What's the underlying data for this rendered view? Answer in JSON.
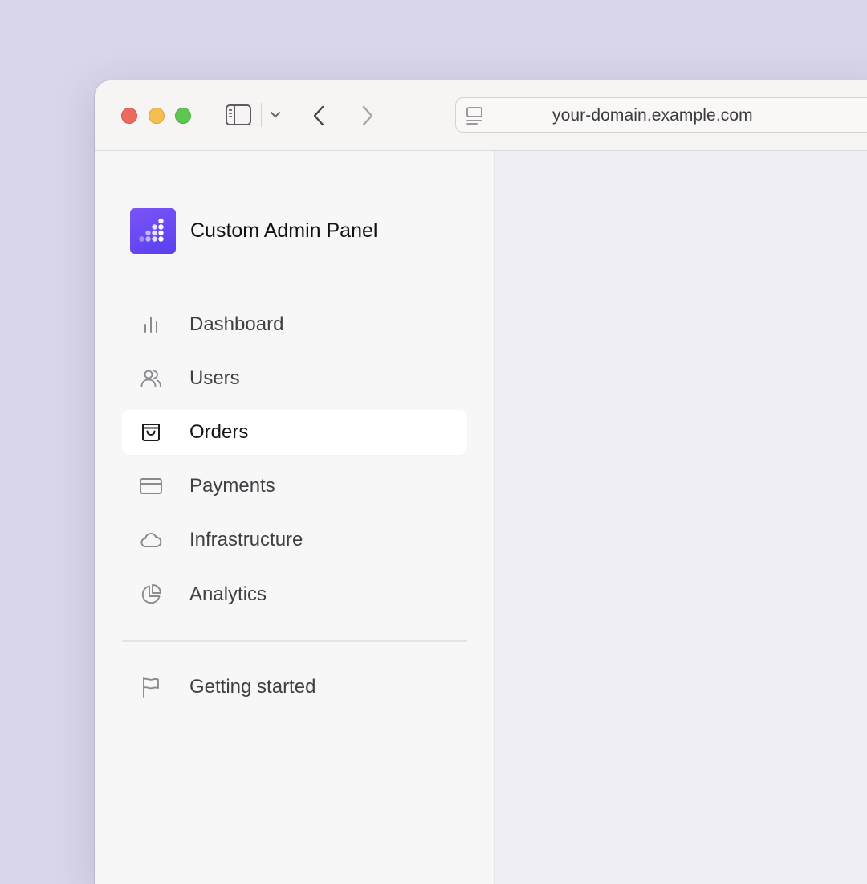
{
  "browser": {
    "url": "your-domain.example.com",
    "icons": [
      "sidebar-toggle-icon",
      "chevron-down-icon",
      "back-arrow-icon",
      "forward-arrow-icon",
      "page-icon"
    ]
  },
  "app": {
    "title": "Custom Admin Panel",
    "logo_icon": "dot-grid-logo-icon",
    "accent": "#6347f4"
  },
  "nav": {
    "items": [
      {
        "label": "Dashboard",
        "icon": "bar-chart-icon",
        "active": false
      },
      {
        "label": "Users",
        "icon": "users-icon",
        "active": false
      },
      {
        "label": "Orders",
        "icon": "shopping-bag-icon",
        "active": true
      },
      {
        "label": "Payments",
        "icon": "credit-card-icon",
        "active": false
      },
      {
        "label": "Infrastructure",
        "icon": "cloud-icon",
        "active": false
      },
      {
        "label": "Analytics",
        "icon": "pie-chart-icon",
        "active": false
      }
    ],
    "footer_items": [
      {
        "label": "Getting started",
        "icon": "flag-icon",
        "active": false
      }
    ]
  }
}
